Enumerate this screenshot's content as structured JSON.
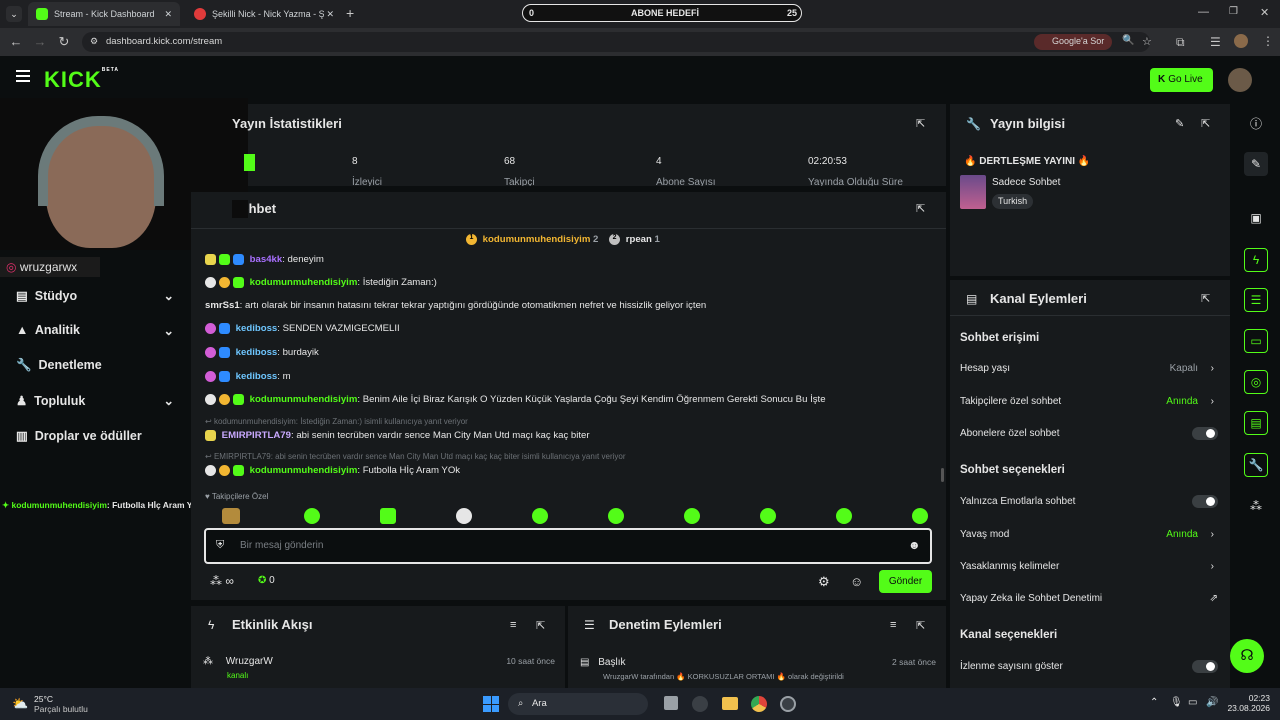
{
  "browser": {
    "tabs": [
      {
        "label": "Stream - Kick Dashboard"
      },
      {
        "label": "Şekilli Nick - Nick Yazma - Şekil"
      }
    ],
    "goal_bar": {
      "left": "0",
      "title": "ABONE HEDEFİ",
      "right": "25"
    },
    "url": "dashboard.kick.com/stream",
    "google_btn": "Google'a Sor"
  },
  "header": {
    "logo": "KICK",
    "beta": "BETA",
    "go_live": "Go Live"
  },
  "webcam": {
    "handle": "wruzgarwx"
  },
  "sidebar": {
    "items": [
      {
        "label": "Stüdyo"
      },
      {
        "label": "Analitik"
      },
      {
        "label": "Denetleme"
      },
      {
        "label": "Topluluk"
      },
      {
        "label": "Droplar ve ödüller"
      }
    ]
  },
  "overlay_chat": {
    "user": "kodumunmuhendisiyim",
    "text": ": Futbolla Hİç Aram YOk"
  },
  "stats": {
    "title": "Yayın İstatistikleri",
    "cells": [
      {
        "value": "8",
        "label": "İzleyici"
      },
      {
        "value": "68",
        "label": "Takipçi"
      },
      {
        "value": "4",
        "label": "Abone Sayısı"
      },
      {
        "value": "02:20:53",
        "label": "Yayında Olduğu Süre"
      }
    ]
  },
  "chat": {
    "title": "Sohbet",
    "top_users": [
      {
        "rank": "1",
        "name": "kodumunmuhendisiyim",
        "count": "2"
      },
      {
        "rank": "2",
        "name": "rpean",
        "count": "1"
      }
    ],
    "messages": [
      {
        "user": "bas4kk",
        "color": "#a970ff",
        "text": ": deneyim"
      },
      {
        "user": "kodumunmuhendisiyim",
        "color": "#53fc18",
        "text": ": İstediğin Zaman:)"
      },
      {
        "user": "smrSs1",
        "color": "#e6e6e6",
        "text": ": artı olarak bir insanın hatasını tekrar tekrar yaptığını gördüğünde otomatikmen nefret ve hissizlik geliyor içten"
      },
      {
        "user": "kediboss",
        "color": "#6ec6ff",
        "text": ": SENDEN VAZMIGECMELII"
      },
      {
        "user": "kediboss",
        "color": "#6ec6ff",
        "text": ": burdayik"
      },
      {
        "user": "kediboss",
        "color": "#6ec6ff",
        "text": ": m"
      },
      {
        "user": "kodumunmuhendisiyim",
        "color": "#53fc18",
        "text": ": Benim Aile İçi Biraz Karışık O Yüzden Küçük Yaşlarda Çoğu Şeyi Kendim Öğrenmem Gerekti Sonucu Bu İşte"
      },
      {
        "user": "EMIRPIRTLA79",
        "color": "#c9a9ff",
        "text": ": abi senin tecrüben vardır sence Man City Man Utd maçı kaç kaç biter"
      },
      {
        "user": "kodumunmuhendisiyim",
        "color": "#53fc18",
        "text": ": Futbolla Hİç Aram YOk"
      }
    ],
    "replies": [
      "kodumunmuhendisiyim: İstediğin Zaman:) isimli kullanıcıya yanıt veriyor",
      "EMIRPIRTLA79: abi senin tecrüben vardır sence Man City Man Utd maçı kaç kaç biter isimli kullanıcıya yanıt veriyor"
    ],
    "followers_only": "Takipçilere Özel",
    "input_placeholder": "Bir mesaj gönderin",
    "infinity": "∞",
    "points": "0",
    "send": "Gönder"
  },
  "activity": {
    "title": "Etkinlik Akışı",
    "user": "WruzgarW",
    "time": "10 saat önce",
    "sub": "kanalı"
  },
  "moderation": {
    "title": "Denetim Eylemleri",
    "label": "Başlık",
    "time": "2 saat önce",
    "detail": "WruzgarW tarafından 🔥 KORKUSUZLAR ORTAMI 🔥 olarak değiştirildi"
  },
  "stream_info": {
    "title": "Yayın bilgisi",
    "stream_title": "🔥 DERTLEŞME YAYINI 🔥",
    "category": "Sadece Sohbet",
    "language": "Turkish"
  },
  "channel_actions": {
    "title": "Kanal Eylemleri",
    "sections": [
      {
        "heading": "Sohbet erişimi"
      },
      {
        "heading": "Sohbet seçenekleri"
      },
      {
        "heading": "Kanal seçenekleri"
      }
    ],
    "rows": [
      {
        "label": "Hesap yaşı",
        "value": "Kapalı"
      },
      {
        "label": "Takipçilere özel sohbet",
        "value": "Anında"
      },
      {
        "label": "Abonelere özel sohbet",
        "value": ""
      },
      {
        "label": "Yalnızca Emotlarla sohbet",
        "value": ""
      },
      {
        "label": "Yavaş mod",
        "value": "Anında"
      },
      {
        "label": "Yasaklanmış kelimeler",
        "value": ""
      },
      {
        "label": "Yapay Zeka ile Sohbet Denetimi",
        "value": ""
      },
      {
        "label": "İzlenme sayısını göster",
        "value": ""
      }
    ]
  },
  "taskbar": {
    "temp": "25°C",
    "weather": "Parçalı bulutlu",
    "search": "Ara",
    "time": "02:23",
    "date": "23.08.2026"
  }
}
